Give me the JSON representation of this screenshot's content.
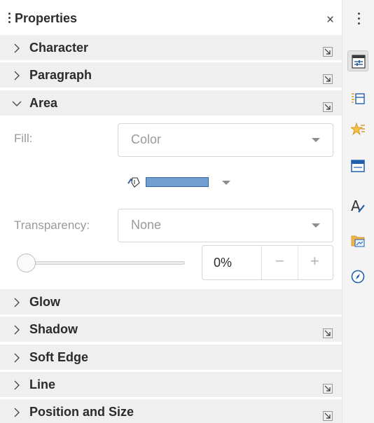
{
  "deck": {
    "title": "Properties",
    "close_glyph": "×"
  },
  "sections": {
    "character": "Character",
    "paragraph": "Paragraph",
    "area": "Area",
    "glow": "Glow",
    "shadow": "Shadow",
    "soft_edge": "Soft Edge",
    "line": "Line",
    "position_and_size": "Position and Size"
  },
  "area": {
    "fill_label": "Fill:",
    "fill_value": "Color",
    "fill_color": "#729fcf",
    "transparency_label": "Transparency:",
    "transparency_value": "None",
    "transparency_percent": "0%",
    "minus_glyph": "−",
    "plus_glyph": "+"
  },
  "tabbar": {
    "icons": [
      "properties-icon",
      "styles-icon",
      "gallery-icon",
      "navigator-page-icon",
      "fontwork-icon",
      "gallery-folder-icon",
      "navigator-icon"
    ],
    "active": "properties-icon"
  }
}
